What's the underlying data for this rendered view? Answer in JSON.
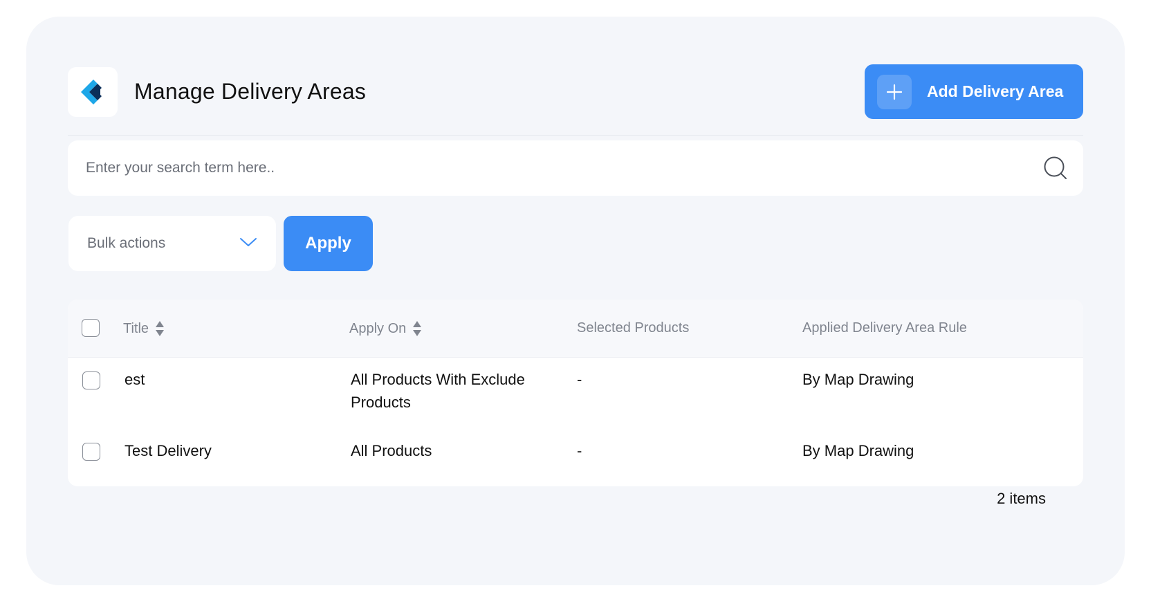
{
  "header": {
    "title": "Manage Delivery Areas",
    "add_button_label": "Add Delivery Area",
    "logo_icon": "brand-logo-icon",
    "accent_color": "#3b8cf5"
  },
  "search": {
    "placeholder": "Enter your search term here..",
    "value": "",
    "icon": "search-icon"
  },
  "bulk_actions": {
    "selected": "Bulk actions",
    "apply_label": "Apply"
  },
  "table": {
    "columns": [
      "Title",
      "Apply On",
      "Selected Products",
      "Applied Delivery Area Rule"
    ],
    "rows": [
      {
        "title": "est",
        "apply_on": "All Products With Exclude Products",
        "selected_products": "-",
        "rule": "By Map Drawing"
      },
      {
        "title": "Test Delivery",
        "apply_on": "All Products",
        "selected_products": "-",
        "rule": "By Map Drawing"
      }
    ]
  },
  "footer": {
    "item_count": "2 items"
  }
}
